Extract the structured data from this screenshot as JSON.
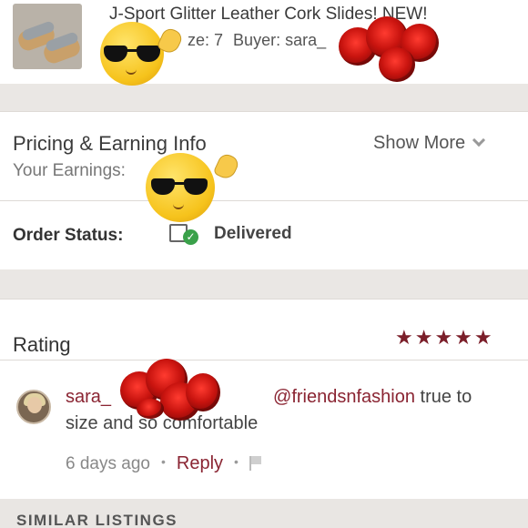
{
  "product": {
    "title": "J-Sport Glitter Leather Cork Slides! NEW!",
    "size_text": "ze: 7",
    "buyer_text": "Buyer: sara_"
  },
  "pricing": {
    "title": "Pricing & Earning Info",
    "show_more": "Show More",
    "earnings_label": "Your Earnings:"
  },
  "order": {
    "status_label": "Order Status:",
    "status_value": "Delivered"
  },
  "rating": {
    "label": "Rating",
    "stars": "★★★★★",
    "stars_count": 5
  },
  "comment": {
    "author": "sara_",
    "mention": "@friendsnfashion",
    "text_after_mention": " true to",
    "text_line2": "size and so comfortable",
    "time": "6 days ago",
    "dot": "•",
    "reply": "Reply"
  },
  "similar": {
    "label": "SIMILAR LISTINGS"
  },
  "colors": {
    "accent": "#8a2432",
    "stars": "#7b1f2a",
    "delivered_check": "#3aa14a",
    "section_gap": "#eae7e4"
  },
  "icons": [
    "chevron-down-icon",
    "delivered-check-icon",
    "flag-icon",
    "star-icon",
    "emoji-sunglasses-sticker",
    "rose-sticker"
  ]
}
